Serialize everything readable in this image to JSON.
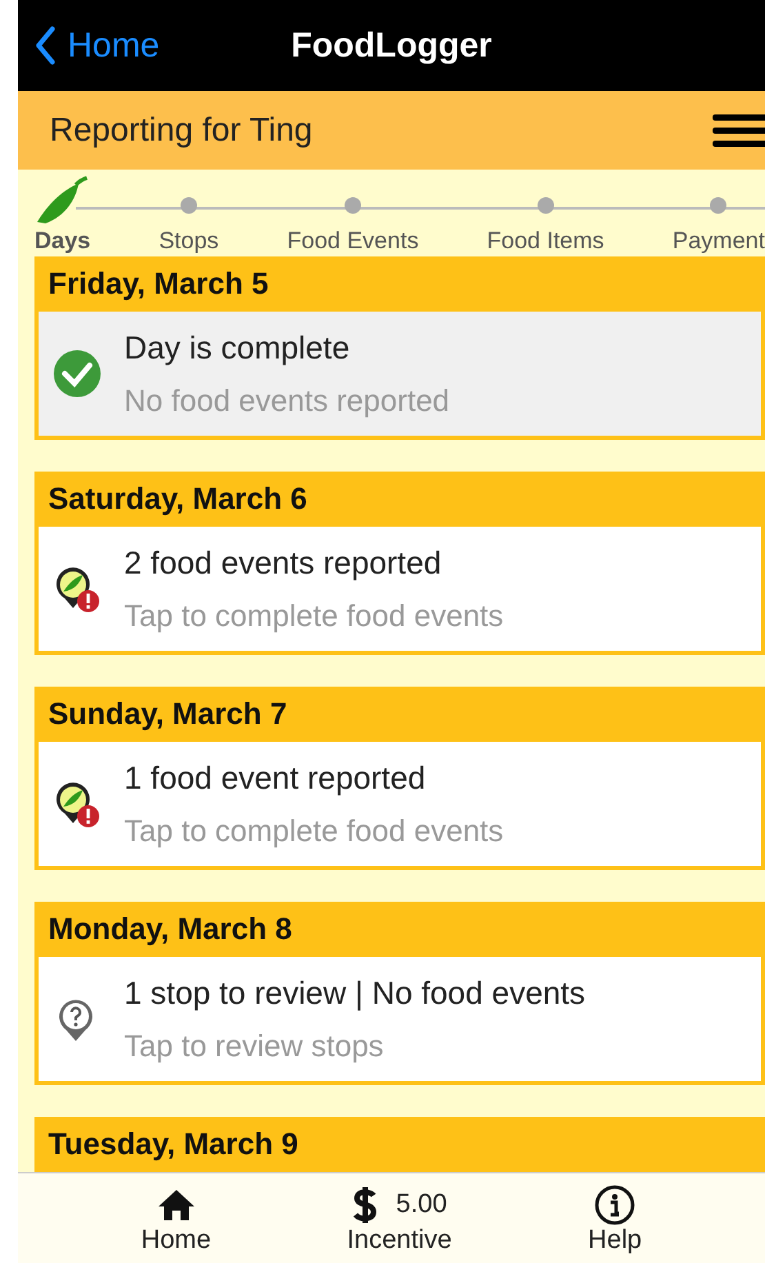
{
  "nav_bar": {
    "back_label": "Home",
    "title": "FoodLogger"
  },
  "header": {
    "title": "Reporting for Ting"
  },
  "steps": [
    {
      "label": "Days",
      "selected": true
    },
    {
      "label": "Stops",
      "selected": false
    },
    {
      "label": "Food Events",
      "selected": false
    },
    {
      "label": "Food Items",
      "selected": false
    },
    {
      "label": "Payment",
      "selected": false
    }
  ],
  "days": [
    {
      "date": "Friday, March 5",
      "kind": "complete",
      "status": "Day is complete",
      "hint": "No food events reported"
    },
    {
      "date": "Saturday, March 6",
      "kind": "food_pending",
      "status": "2 food events reported",
      "hint": "Tap to complete food events"
    },
    {
      "date": "Sunday, March 7",
      "kind": "food_pending",
      "status": "1 food event reported",
      "hint": "Tap to complete food events"
    },
    {
      "date": "Monday, March 8",
      "kind": "review",
      "status": "1 stop to review | No food events",
      "hint": "Tap to review stops"
    },
    {
      "date": "Tuesday, March 9",
      "kind": "header_only"
    }
  ],
  "tab_bar": [
    {
      "kind": "home",
      "label": "Home"
    },
    {
      "kind": "incentive",
      "label": "Incentive",
      "amount": "5.00"
    },
    {
      "kind": "help",
      "label": "Help"
    }
  ]
}
